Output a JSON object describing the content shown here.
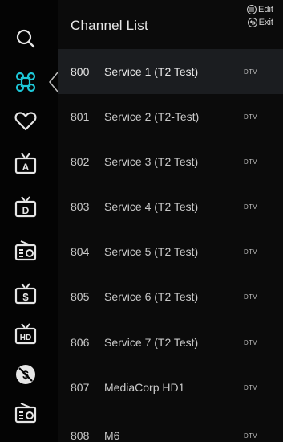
{
  "header": {
    "title": "Channel List",
    "hint_edit": "Edit",
    "hint_exit": "Exit"
  },
  "sidebar": {
    "icons": [
      {
        "name": "search-icon"
      },
      {
        "name": "all-channels-icon",
        "selected": true
      },
      {
        "name": "favorite-heart-icon"
      },
      {
        "name": "analog-tv-icon",
        "letter": "A"
      },
      {
        "name": "digital-tv-icon",
        "letter": "D"
      },
      {
        "name": "radio-icon"
      },
      {
        "name": "pay-tv-icon",
        "letter": "$"
      },
      {
        "name": "hd-tv-icon",
        "letter": "HD"
      },
      {
        "name": "free-tv-icon",
        "letter": "$"
      },
      {
        "name": "radio-icon"
      }
    ]
  },
  "channels": [
    {
      "number": "800",
      "name": "Service 1 (T2 Test)",
      "type": "DTV"
    },
    {
      "number": "801",
      "name": "Service 2 (T2-Test)",
      "type": "DTV"
    },
    {
      "number": "802",
      "name": "Service 3 (T2 Test)",
      "type": "DTV"
    },
    {
      "number": "803",
      "name": "Service 4 (T2 Test)",
      "type": "DTV"
    },
    {
      "number": "804",
      "name": "Service 5 (T2 Test)",
      "type": "DTV"
    },
    {
      "number": "805",
      "name": "Service 6 (T2 Test)",
      "type": "DTV"
    },
    {
      "number": "806",
      "name": "Service 7 (T2 Test)",
      "type": "DTV"
    },
    {
      "number": "807",
      "name": "MediaCorp HD1",
      "type": "DTV"
    },
    {
      "number": "808",
      "name": "M6",
      "type": "DTV"
    }
  ],
  "colors": {
    "accent": "#1ec8d8",
    "icon": "#e6e6e6",
    "selected_row": "#1b1d20"
  }
}
